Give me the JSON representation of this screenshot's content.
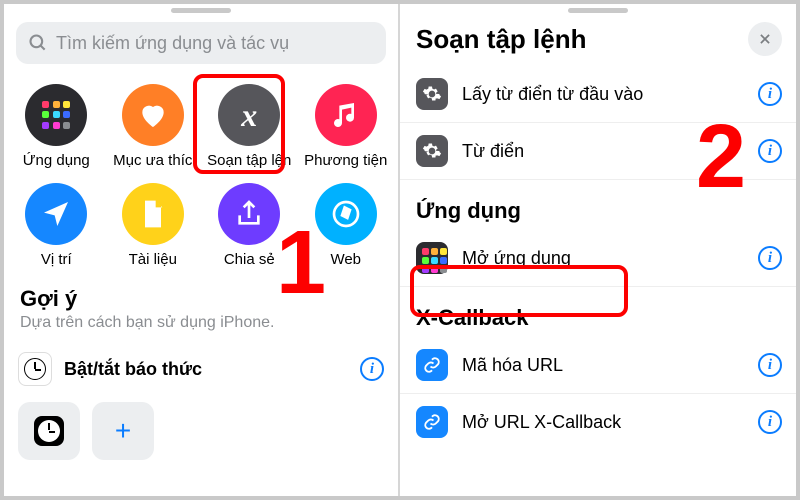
{
  "left": {
    "search_placeholder": "Tìm kiếm ứng dụng và tác vụ",
    "categories": [
      {
        "id": "apps",
        "label": "Ứng dụng"
      },
      {
        "id": "fav",
        "label": "Mục ưa thíc"
      },
      {
        "id": "script",
        "label": "Soạn tập lện"
      },
      {
        "id": "media",
        "label": "Phương tiện"
      },
      {
        "id": "loc",
        "label": "Vị trí"
      },
      {
        "id": "doc",
        "label": "Tài liệu"
      },
      {
        "id": "share",
        "label": "Chia sẻ"
      },
      {
        "id": "web",
        "label": "Web"
      }
    ],
    "suggest_header": "Gợi ý",
    "suggest_sub": "Dựa trên cách bạn sử dụng iPhone.",
    "suggest_item": "Bật/tắt báo thức",
    "annotation": "1"
  },
  "right": {
    "title": "Soạn tập lệnh",
    "top_rows": [
      {
        "label": "Lấy từ điển từ đầu vào"
      },
      {
        "label": "Từ điển"
      }
    ],
    "section_app": "Ứng dụng",
    "app_rows": [
      {
        "label": "Mở ứng dụng"
      }
    ],
    "section_xcb": "X-Callback",
    "xcb_rows": [
      {
        "label": "Mã hóa URL"
      },
      {
        "label": "Mở URL X-Callback"
      }
    ],
    "annotation": "2"
  }
}
